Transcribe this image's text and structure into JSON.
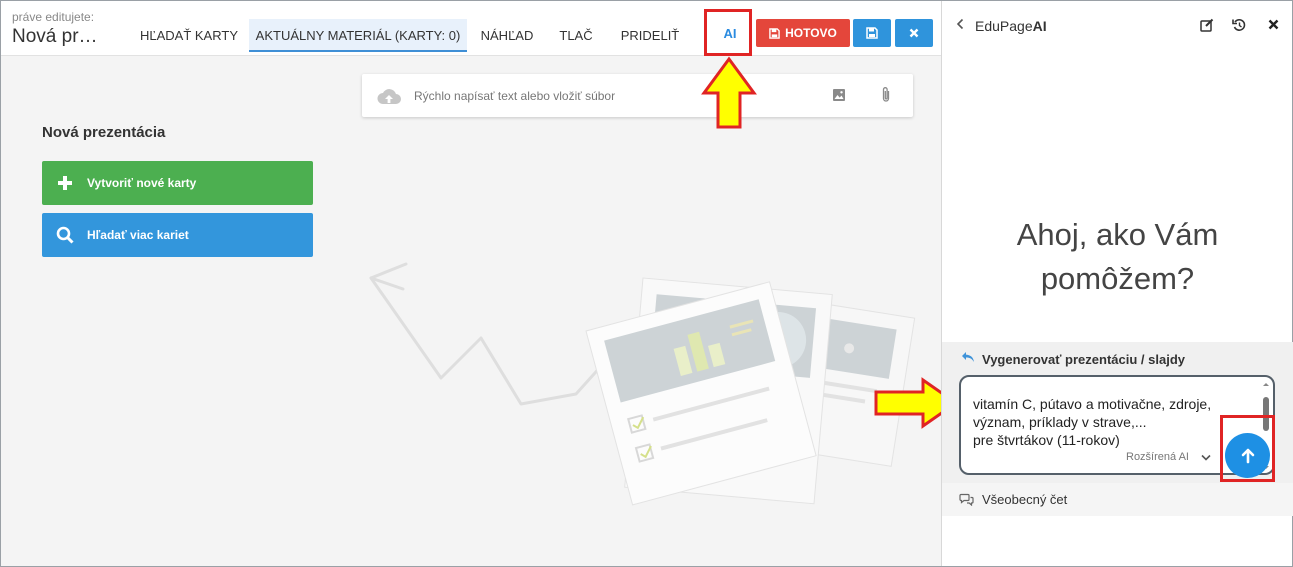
{
  "editor": {
    "editing_caption": "práve editujete:",
    "editing_title": "Nová pr…",
    "tabs": [
      {
        "label": "HĽADAŤ KARTY"
      },
      {
        "label": "AKTUÁLNY MATERIÁL (KARTY: 0)"
      },
      {
        "label": "NÁHĽAD"
      },
      {
        "label": "TLAČ"
      },
      {
        "label": "PRIDELIŤ"
      }
    ],
    "ai_label": "AI",
    "done_label": "HOTOVO",
    "quick_input_placeholder": "Rýchlo napísať text alebo vložiť súbor",
    "new_presentation_heading": "Nová prezentácia",
    "create_cards_label": "Vytvoriť nové karty",
    "find_cards_label": "Hľadať viac kariet"
  },
  "panel": {
    "title_plain": "EduPage",
    "title_bold": "AI",
    "greeting_line1": "Ahoj, ako Vám",
    "greeting_line2": "pomôžem?",
    "generate_title": "Vygenerovať prezentáciu / slajdy",
    "prompt_text": "vitamín C, pútavo a motivačne, zdroje,\nvýznam, príklady v strave,...\npre štvrtákov (11-rokov)",
    "mode_label": "Rozšírená AI",
    "general_chat_label": "Všeobecný čet"
  },
  "colors": {
    "highlight_red": "#e02424",
    "arrow_yellow": "#ffff00",
    "done_red": "#e4463b",
    "primary_blue": "#2f94dc",
    "create_green": "#4caf50",
    "send_blue": "#1e90e4"
  },
  "icons": {
    "save": "floppy-disk-icon",
    "close": "close-icon",
    "upload": "cloud-upload-icon",
    "image": "image-icon",
    "attach": "paperclip-icon",
    "plus": "plus-icon",
    "search": "search-icon",
    "back": "chevron-left-icon",
    "edit": "edit-icon",
    "history": "history-icon",
    "reply": "reply-icon",
    "chevron": "chevron-down-icon",
    "send": "arrow-up-icon",
    "chat": "chat-bubbles-icon"
  }
}
